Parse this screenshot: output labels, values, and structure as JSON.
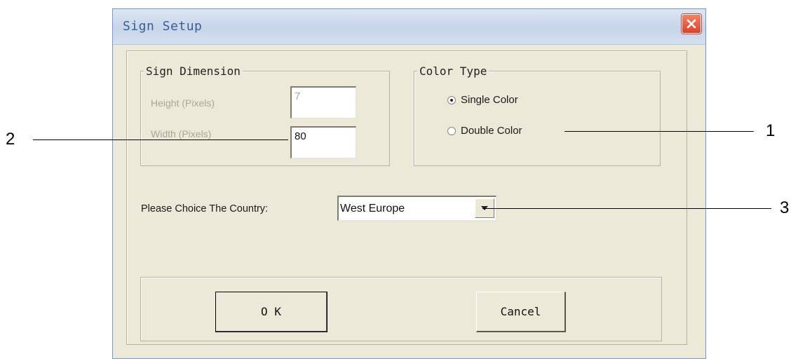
{
  "window": {
    "title": "Sign Setup"
  },
  "sign_dimension": {
    "legend": "Sign Dimension",
    "height_label": "Height (Pixels)",
    "height_value": "7",
    "width_label": "Width (Pixels)",
    "width_value": "80"
  },
  "color_type": {
    "legend": "Color Type",
    "options": [
      {
        "label": "Single Color",
        "selected": true
      },
      {
        "label": "Double Color",
        "selected": false
      }
    ]
  },
  "country": {
    "label": "Please Choice The Country:",
    "selected": "West Europe"
  },
  "buttons": {
    "ok": "O K",
    "cancel": "Cancel"
  },
  "callouts": [
    "1",
    "2",
    "3"
  ],
  "colors": {
    "title_text": "#3a5f9a",
    "close_button": "#d9432a",
    "dialog_bg": "#ece9d8"
  }
}
